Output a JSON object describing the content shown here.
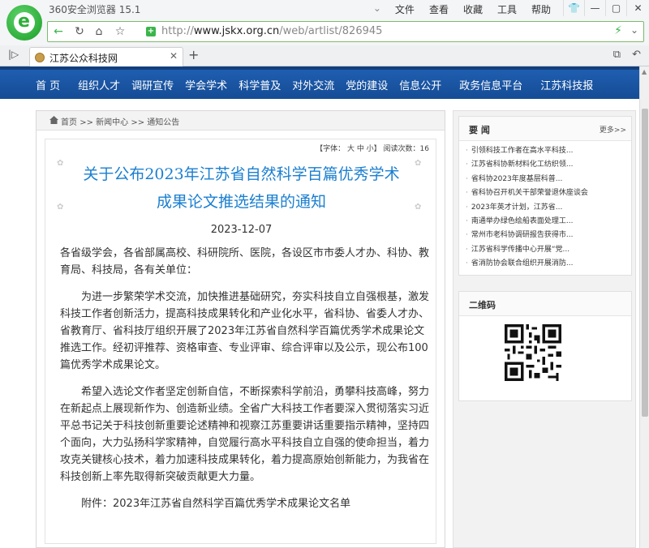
{
  "browser": {
    "app_title": "360安全浏览器 15.1",
    "menu": [
      "文件",
      "查看",
      "收藏",
      "工具",
      "帮助"
    ],
    "url_prefix": "http://",
    "url_host": "www.jskx.org.cn",
    "url_path": "/web/artlist/826945",
    "tab_title": "江苏公众科技网"
  },
  "nav": {
    "items": [
      "首 页",
      "组织人才",
      "调研宣传",
      "学会学术",
      "科学普及",
      "对外交流",
      "党的建设",
      "信息公开",
      "政务信息平台",
      "江苏科技报"
    ]
  },
  "breadcrumb": {
    "home": "首页",
    "sep": ">>",
    "level1": "新闻中心",
    "level2": "通知公告"
  },
  "article": {
    "tools": "【字体： 大 中 小】 阅读次数：16",
    "title_line1": "关于公布2023年江苏省自然科学百篇优秀学术",
    "title_line2": "成果论文推选结果的通知",
    "date": "2023-12-07",
    "p1": "各省级学会，各省部属高校、科研院所、医院，各设区市市委人才办、科协、教育局、科技局，各有关单位：",
    "p2": "为进一步繁荣学术交流，加快推进基础研究，夯实科技自立自强根基，激发科技工作者创新活力，提高科技成果转化和产业化水平，省科协、省委人才办、省教育厅、省科技厅组织开展了2023年江苏省自然科学百篇优秀学术成果论文推选工作。经初评推荐、资格审查、专业评审、综合评审以及公示，现公布100篇优秀学术成果论文。",
    "p3": "希望入选论文作者坚定创新自信，不断探索科学前沿，勇攀科技高峰，努力在新起点上展现新作为、创造新业绩。全省广大科技工作者要深入贯彻落实习近平总书记关于科技创新重要论述精神和视察江苏重要讲话重要指示精神，坚持四个面向，大力弘扬科学家精神，自觉履行高水平科技自立自强的使命担当，着力攻克关键核心技术，着力加速科技成果转化，着力提高原始创新能力，为我省在科技创新上率先取得新突破贡献更大力量。",
    "p4": "附件：2023年江苏省自然科学百篇优秀学术成果论文名单"
  },
  "sidebar": {
    "news_title": "要 闻",
    "more": "更多>>",
    "news": [
      "引领科技工作者在高水平科技...",
      "江苏省科协新材料化工纺织领...",
      "省科协2023年度基层科普...",
      "省科协召开机关干部荣誉退休座谈会",
      "2023年英才计划，江苏省...",
      "南通举办绿色绘船表面处理工...",
      "常州市老科协调研报告获得市...",
      "江苏省科学传播中心开展“党...",
      "省消防协会联合组织开展消防..."
    ],
    "qr_title": "二维码"
  }
}
